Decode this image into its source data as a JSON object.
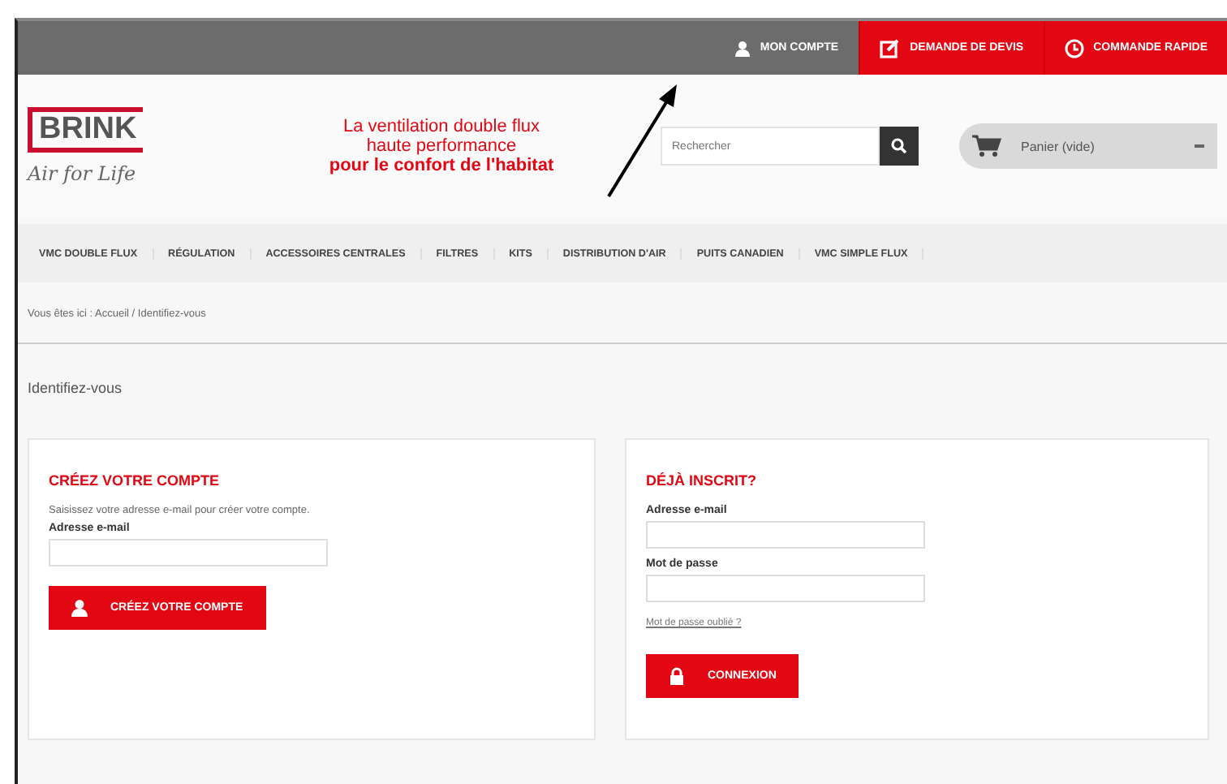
{
  "top_bar": [
    {
      "kind": "account",
      "label": "MON COMPTE"
    },
    {
      "kind": "quote",
      "label": "DEMANDE DE DEVIS"
    },
    {
      "kind": "order",
      "label": "COMMANDE RAPIDE"
    }
  ],
  "logo": {
    "name": "BRINK",
    "slogan": "Air for Life"
  },
  "tagline": [
    "La ventilation double flux",
    "haute performance",
    "pour le confort de l'habitat"
  ],
  "search": {
    "placeholder": "Rechercher"
  },
  "cart": {
    "label": "Panier (vide)"
  },
  "nav": [
    "VMC DOUBLE FLUX",
    "RÉGULATION",
    "ACCESSOIRES CENTRALES",
    "FILTRES",
    "KITS",
    "DISTRIBUTION D'AIR",
    "PUITS CANADIEN",
    "VMC SIMPLE FLUX"
  ],
  "breadcrumb": "Vous êtes ici : Accueil / Identifiez-vous",
  "page_title": "Identifiez-vous",
  "create_account": {
    "title": "CRÉEZ VOTRE COMPTE",
    "intro": "Saisissez votre adresse e-mail pour créer votre compte.",
    "email_label": "Adresse e-mail",
    "button": "CRÉEZ VOTRE COMPTE"
  },
  "login": {
    "title": "DÉJÀ INSCRIT?",
    "email_label": "Adresse e-mail",
    "password_label": "Mot de passe",
    "forgot_link": "Mot de passe oublié ?",
    "button": "CONNEXION"
  }
}
